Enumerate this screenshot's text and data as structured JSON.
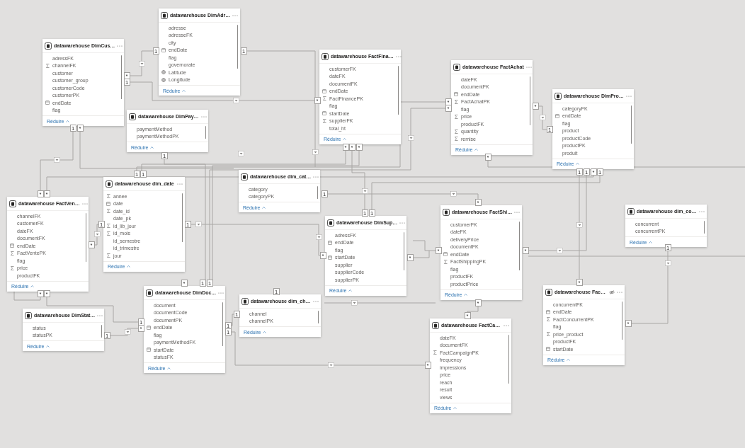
{
  "tables": [
    {
      "title": "datawarehouse DimCus…",
      "hidden": false,
      "fields": [
        {
          "name": "adressFK",
          "kind": "text"
        },
        {
          "name": "channelFK",
          "kind": "sum"
        },
        {
          "name": "customer",
          "kind": "text"
        },
        {
          "name": "customer_group",
          "kind": "text"
        },
        {
          "name": "customerCode",
          "kind": "text"
        },
        {
          "name": "customerPK",
          "kind": "text"
        },
        {
          "name": "endDate",
          "kind": "date"
        },
        {
          "name": "flag",
          "kind": "text"
        }
      ],
      "markers": [
        "*",
        "1",
        "1",
        "*"
      ],
      "footer": "Réduire"
    },
    {
      "title": "datawarehouse DimAdr…",
      "hidden": false,
      "fields": [
        {
          "name": "adresse",
          "kind": "text"
        },
        {
          "name": "adresseFK",
          "kind": "text"
        },
        {
          "name": "city",
          "kind": "text"
        },
        {
          "name": "endDate",
          "kind": "date"
        },
        {
          "name": "flag",
          "kind": "text"
        },
        {
          "name": "governorate",
          "kind": "text"
        },
        {
          "name": "Latitude",
          "kind": "geo"
        },
        {
          "name": "Longitude",
          "kind": "geo"
        }
      ],
      "markers": [
        "1",
        "1"
      ],
      "footer": "Réduire"
    },
    {
      "title": "datawarehouse DimPay…",
      "hidden": false,
      "fields": [
        {
          "name": "paymentMethod",
          "kind": "text"
        },
        {
          "name": "paymentMethodPK",
          "kind": "text"
        }
      ],
      "markers": [
        "1"
      ],
      "footer": "Réduire"
    },
    {
      "title": "datawarehouse FactFina…",
      "hidden": false,
      "fields": [
        {
          "name": "customerFK",
          "kind": "text"
        },
        {
          "name": "dateFK",
          "kind": "text"
        },
        {
          "name": "documentFK",
          "kind": "text"
        },
        {
          "name": "endDate",
          "kind": "date"
        },
        {
          "name": "FactFinancePK",
          "kind": "sum"
        },
        {
          "name": "flag",
          "kind": "text"
        },
        {
          "name": "startDate",
          "kind": "date"
        },
        {
          "name": "supplierFK",
          "kind": "sum"
        },
        {
          "name": "total_ht",
          "kind": "text"
        }
      ],
      "markers": [
        "*",
        "*",
        "*",
        "*"
      ],
      "footer": "Réduire"
    },
    {
      "title": "datawarehouse FactAchat",
      "hidden": false,
      "fields": [
        {
          "name": "dateFK",
          "kind": "text"
        },
        {
          "name": "documentFK",
          "kind": "text"
        },
        {
          "name": "endDate",
          "kind": "date"
        },
        {
          "name": "FactAchatPK",
          "kind": "sum"
        },
        {
          "name": "flag",
          "kind": "text"
        },
        {
          "name": "price",
          "kind": "sum"
        },
        {
          "name": "productFK",
          "kind": "text"
        },
        {
          "name": "quantity",
          "kind": "sum"
        },
        {
          "name": "remise",
          "kind": "sum"
        }
      ],
      "markers": [
        "*",
        "*",
        "*",
        "*"
      ],
      "footer": "Réduire"
    },
    {
      "title": "datawarehouse DimPro…",
      "hidden": false,
      "fields": [
        {
          "name": "categoryFK",
          "kind": "text"
        },
        {
          "name": "endDate",
          "kind": "date"
        },
        {
          "name": "flag",
          "kind": "text"
        },
        {
          "name": "product",
          "kind": "text"
        },
        {
          "name": "productCode",
          "kind": "text"
        },
        {
          "name": "productPK",
          "kind": "text"
        },
        {
          "name": "produit",
          "kind": "text"
        }
      ],
      "markers": [
        "1",
        "1",
        "1",
        "*",
        "1"
      ],
      "footer": "Réduire"
    },
    {
      "title": "datawarehouse dim_cat…",
      "hidden": false,
      "fields": [
        {
          "name": "category",
          "kind": "text"
        },
        {
          "name": "categoryPK",
          "kind": "text"
        }
      ],
      "markers": [
        "1"
      ],
      "footer": "Réduire"
    },
    {
      "title": "datawarehouse FactVen…",
      "hidden": false,
      "fields": [
        {
          "name": "channelFK",
          "kind": "text"
        },
        {
          "name": "customerFK",
          "kind": "text"
        },
        {
          "name": "dateFK",
          "kind": "text"
        },
        {
          "name": "documentFK",
          "kind": "text"
        },
        {
          "name": "endDate",
          "kind": "date"
        },
        {
          "name": "FactVentePK",
          "kind": "sum"
        },
        {
          "name": "flag",
          "kind": "text"
        },
        {
          "name": "price",
          "kind": "sum"
        },
        {
          "name": "productFK",
          "kind": "text"
        }
      ],
      "markers": [
        "*",
        "*",
        "*",
        "*",
        "*"
      ],
      "footer": "Réduire"
    },
    {
      "title": "datawarehouse dim_date",
      "hidden": false,
      "fields": [
        {
          "name": "annee",
          "kind": "sum"
        },
        {
          "name": "date",
          "kind": "date"
        },
        {
          "name": "date_id",
          "kind": "sum"
        },
        {
          "name": "date_pk",
          "kind": "text"
        },
        {
          "name": "id_lib_jour",
          "kind": "sum"
        },
        {
          "name": "id_mois",
          "kind": "sum"
        },
        {
          "name": "id_semestre",
          "kind": "text"
        },
        {
          "name": "id_trimestre",
          "kind": "text"
        },
        {
          "name": "jour",
          "kind": "sum"
        }
      ],
      "markers": [
        "1",
        "1",
        "1",
        "1"
      ],
      "footer": "Réduire"
    },
    {
      "title": "datawarehouse DimStat…",
      "hidden": false,
      "fields": [
        {
          "name": "status",
          "kind": "text"
        },
        {
          "name": "statusPK",
          "kind": "text"
        }
      ],
      "markers": [
        "1"
      ],
      "footer": "Réduire"
    },
    {
      "title": "datawarehouse DimDoc…",
      "hidden": false,
      "fields": [
        {
          "name": "document",
          "kind": "text"
        },
        {
          "name": "documentCode",
          "kind": "text"
        },
        {
          "name": "documentPK",
          "kind": "text"
        },
        {
          "name": "endDate",
          "kind": "date"
        },
        {
          "name": "flag",
          "kind": "text"
        },
        {
          "name": "paymentMethodFK",
          "kind": "text"
        },
        {
          "name": "startDate",
          "kind": "date"
        },
        {
          "name": "statusFK",
          "kind": "text"
        }
      ],
      "markers": [
        "*",
        "1",
        "1",
        "1",
        "*",
        "1",
        "1"
      ],
      "footer": "Réduire"
    },
    {
      "title": "datawarehouse dim_ch…",
      "hidden": false,
      "fields": [
        {
          "name": "channel",
          "kind": "text"
        },
        {
          "name": "channelPK",
          "kind": "text"
        }
      ],
      "markers": [
        "1",
        "1"
      ],
      "footer": "Réduire"
    },
    {
      "title": "datawarehouse DimSup…",
      "hidden": false,
      "fields": [
        {
          "name": "adressFK",
          "kind": "text"
        },
        {
          "name": "endDate",
          "kind": "date"
        },
        {
          "name": "flag",
          "kind": "text"
        },
        {
          "name": "startDate",
          "kind": "date"
        },
        {
          "name": "supplier",
          "kind": "text"
        },
        {
          "name": "supplierCode",
          "kind": "text"
        },
        {
          "name": "supplierPK",
          "kind": "text"
        }
      ],
      "markers": [
        "1",
        "1",
        "*",
        "*"
      ],
      "footer": "Réduire"
    },
    {
      "title": "datawarehouse FactShi…",
      "hidden": false,
      "fields": [
        {
          "name": "customerFK",
          "kind": "text"
        },
        {
          "name": "dateFK",
          "kind": "text"
        },
        {
          "name": "deliveryPrice",
          "kind": "text"
        },
        {
          "name": "documentFK",
          "kind": "text"
        },
        {
          "name": "endDate",
          "kind": "date"
        },
        {
          "name": "FactShippingPK",
          "kind": "sum"
        },
        {
          "name": "flag",
          "kind": "text"
        },
        {
          "name": "productFK",
          "kind": "text"
        },
        {
          "name": "productPrice",
          "kind": "text"
        }
      ],
      "markers": [
        "*",
        "*",
        "*",
        "*"
      ],
      "footer": "Réduire"
    },
    {
      "title": "datawarehouse dim_co…",
      "hidden": false,
      "fields": [
        {
          "name": "concurrent",
          "kind": "text"
        },
        {
          "name": "concurrentPK",
          "kind": "text"
        }
      ],
      "markers": [
        "1"
      ],
      "footer": "Réduire"
    },
    {
      "title": "datawarehouse Fac…",
      "hidden": true,
      "fields": [
        {
          "name": "concurrentFK",
          "kind": "text"
        },
        {
          "name": "endDate",
          "kind": "date"
        },
        {
          "name": "FactConcurrentPK",
          "kind": "sum"
        },
        {
          "name": "flag",
          "kind": "text"
        },
        {
          "name": "price_product",
          "kind": "sum"
        },
        {
          "name": "productFK",
          "kind": "text"
        },
        {
          "name": "startDate",
          "kind": "date"
        }
      ],
      "markers": [
        "*",
        "*"
      ],
      "footer": "Réduire"
    },
    {
      "title": "datawarehouse FactCa…",
      "hidden": false,
      "fields": [
        {
          "name": "dateFK",
          "kind": "text"
        },
        {
          "name": "documentFK",
          "kind": "text"
        },
        {
          "name": "FactCampaignPK",
          "kind": "sum"
        },
        {
          "name": "frequency",
          "kind": "text"
        },
        {
          "name": "impressions",
          "kind": "text"
        },
        {
          "name": "price",
          "kind": "text"
        },
        {
          "name": "reach",
          "kind": "text"
        },
        {
          "name": "result",
          "kind": "text"
        },
        {
          "name": "views",
          "kind": "text"
        }
      ],
      "markers": [
        "*",
        "*"
      ],
      "footer": "Réduire"
    }
  ]
}
